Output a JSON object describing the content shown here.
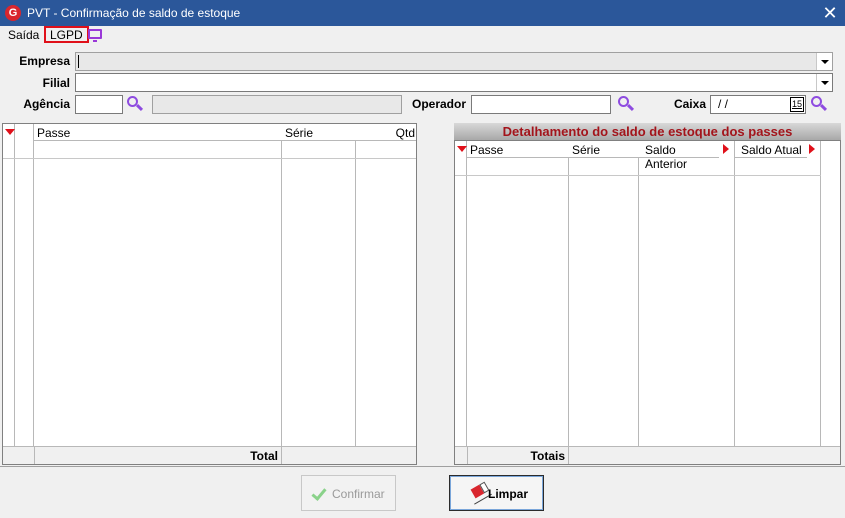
{
  "window": {
    "title": "PVT - Confirmação de saldo de estoque",
    "app_icon": "G",
    "close_glyph": "✕"
  },
  "menu": {
    "items": [
      "Saída",
      "LGPD"
    ],
    "icon": "monitor-icon"
  },
  "form": {
    "empresa_label": "Empresa",
    "filial_label": "Filial",
    "agencia_label": "Agência",
    "operador_label": "Operador",
    "caixa_label": "Caixa",
    "caixa_value": "/ /",
    "calendar_glyph": "15"
  },
  "left_grid": {
    "columns": [
      "Passe",
      "Série",
      "Qtd"
    ],
    "footer_label": "Total"
  },
  "right_grid": {
    "title": "Detalhamento do saldo de estoque dos passes",
    "columns": [
      "Passe",
      "Série",
      "Saldo Anterior",
      "Saldo Atual"
    ],
    "footer_label": "Totais"
  },
  "buttons": {
    "confirmar": "Confirmar",
    "limpar": "Limpar"
  },
  "colors": {
    "titlebar": "#2b579a",
    "accent_red": "#e0101a",
    "title_red": "#a3141b",
    "icon_purple": "#8e4be0"
  }
}
